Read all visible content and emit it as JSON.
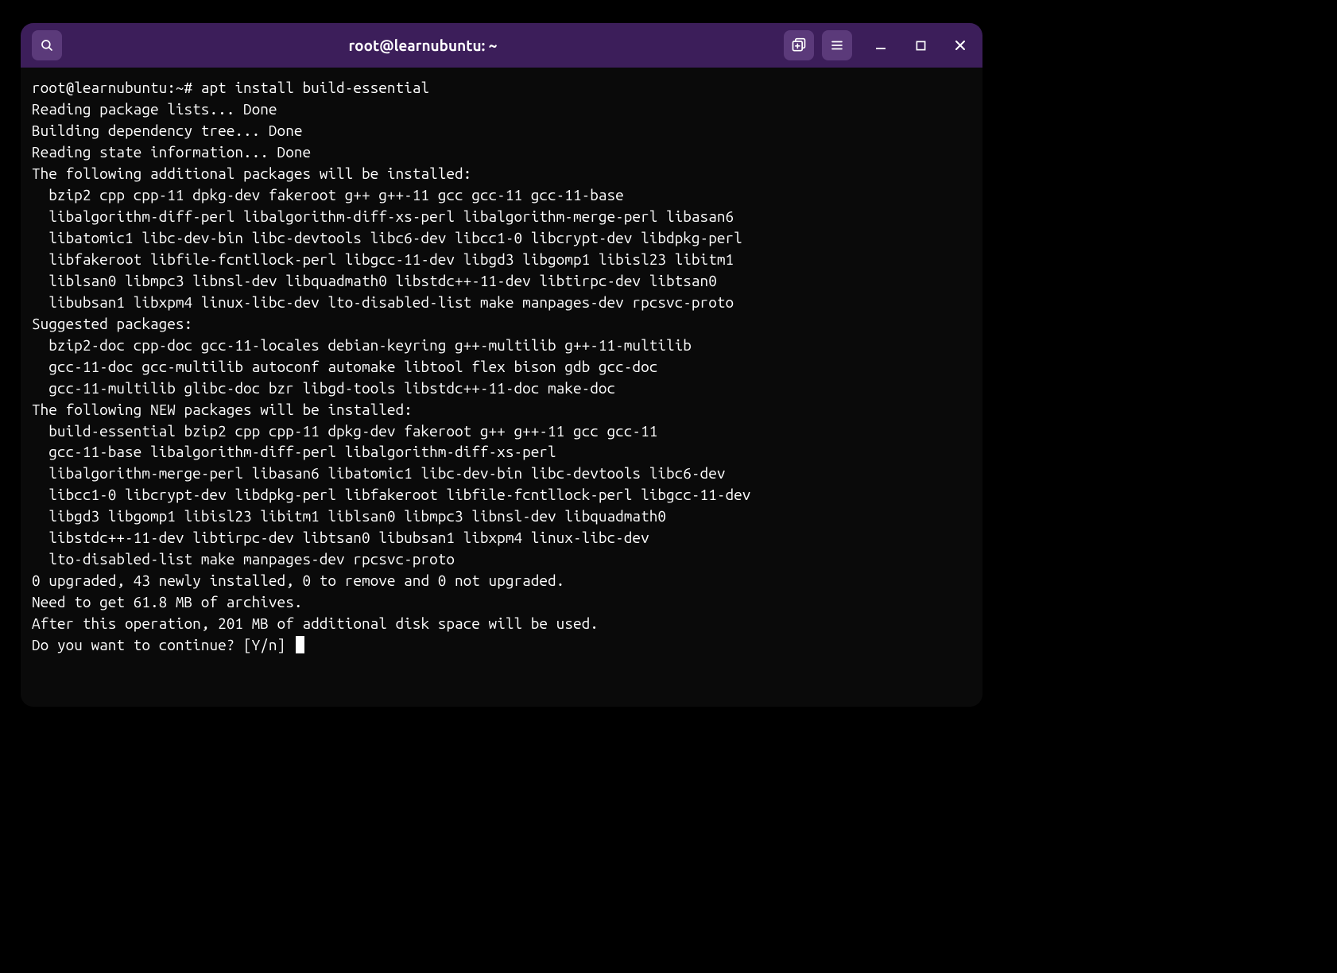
{
  "titlebar": {
    "title": "root@learnubuntu: ~"
  },
  "terminal": {
    "prompt": "root@learnubuntu:~# ",
    "command": "apt install build-essential",
    "lines": {
      "reading_package_lists": "Reading package lists... Done",
      "building_dep_tree": "Building dependency tree... Done",
      "reading_state": "Reading state information... Done",
      "additional_header": "The following additional packages will be installed:",
      "additional_pkgs": [
        "bzip2 cpp cpp-11 dpkg-dev fakeroot g++ g++-11 gcc gcc-11 gcc-11-base",
        "libalgorithm-diff-perl libalgorithm-diff-xs-perl libalgorithm-merge-perl libasan6",
        "libatomic1 libc-dev-bin libc-devtools libc6-dev libcc1-0 libcrypt-dev libdpkg-perl",
        "libfakeroot libfile-fcntllock-perl libgcc-11-dev libgd3 libgomp1 libisl23 libitm1",
        "liblsan0 libmpc3 libnsl-dev libquadmath0 libstdc++-11-dev libtirpc-dev libtsan0",
        "libubsan1 libxpm4 linux-libc-dev lto-disabled-list make manpages-dev rpcsvc-proto"
      ],
      "suggested_header": "Suggested packages:",
      "suggested_pkgs": [
        "bzip2-doc cpp-doc gcc-11-locales debian-keyring g++-multilib g++-11-multilib",
        "gcc-11-doc gcc-multilib autoconf automake libtool flex bison gdb gcc-doc",
        "gcc-11-multilib glibc-doc bzr libgd-tools libstdc++-11-doc make-doc"
      ],
      "new_header": "The following NEW packages will be installed:",
      "new_pkgs": [
        "build-essential bzip2 cpp cpp-11 dpkg-dev fakeroot g++ g++-11 gcc gcc-11",
        "gcc-11-base libalgorithm-diff-perl libalgorithm-diff-xs-perl",
        "libalgorithm-merge-perl libasan6 libatomic1 libc-dev-bin libc-devtools libc6-dev",
        "libcc1-0 libcrypt-dev libdpkg-perl libfakeroot libfile-fcntllock-perl libgcc-11-dev",
        "libgd3 libgomp1 libisl23 libitm1 liblsan0 libmpc3 libnsl-dev libquadmath0",
        "libstdc++-11-dev libtirpc-dev libtsan0 libubsan1 libxpm4 linux-libc-dev",
        "lto-disabled-list make manpages-dev rpcsvc-proto"
      ],
      "summary": "0 upgraded, 43 newly installed, 0 to remove and 0 not upgraded.",
      "download": "Need to get 61.8 MB of archives.",
      "disk": "After this operation, 201 MB of additional disk space will be used.",
      "prompt_continue": "Do you want to continue? [Y/n] "
    }
  }
}
